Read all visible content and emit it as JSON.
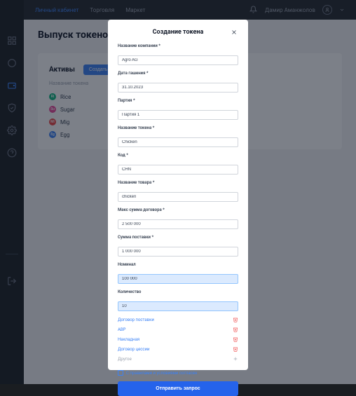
{
  "topbar": {
    "nav": [
      "Личный кабинет",
      "Торговля",
      "Маркет"
    ],
    "activeIndex": 0,
    "username": "Дамир Аманжолов"
  },
  "page": {
    "title": "Выпуск токенов"
  },
  "panel": {
    "title": "Активы",
    "createLabel": "Создать",
    "subLabel": "Название токена",
    "assets": [
      {
        "code": "Ri",
        "name": "Rice",
        "color": "#10b981"
      },
      {
        "code": "Su",
        "name": "Sugar",
        "color": "#ec4899"
      },
      {
        "code": "Mi",
        "name": "Mig",
        "color": "#ef4444"
      },
      {
        "code": "Eg",
        "name": "Egg",
        "color": "#3b82f6"
      }
    ]
  },
  "modal": {
    "title": "Создание токена",
    "fields": [
      {
        "label": "Название компании *",
        "value": "Agro AG",
        "highlight": false
      },
      {
        "label": "Дата гашения *",
        "value": "31.10.2023",
        "highlight": false
      },
      {
        "label": "Партия *",
        "value": "Партия 1",
        "highlight": false
      },
      {
        "label": "Название токена *",
        "value": "Chicken",
        "highlight": false
      },
      {
        "label": "Код *",
        "value": "CHN",
        "highlight": false
      },
      {
        "label": "Название товара *",
        "value": "chicken",
        "highlight": false
      },
      {
        "label": "Макс сумма договора *",
        "value": "2 500 000",
        "highlight": false
      },
      {
        "label": "Сумма поставки *",
        "value": "1 000 000",
        "highlight": false
      },
      {
        "label": "Номинал",
        "value": "100 000",
        "highlight": true
      },
      {
        "label": "Количество",
        "value": "10",
        "highlight": true
      }
    ],
    "files": [
      {
        "label": "Договор поставки",
        "active": true
      },
      {
        "label": "АВР",
        "active": true
      },
      {
        "label": "Накладная",
        "active": true
      },
      {
        "label": "Договор цессии",
        "active": true
      },
      {
        "label": "Другое",
        "active": false
      }
    ],
    "consent": "С правилами и условиями согласен",
    "submit": "Отправить запрос"
  }
}
